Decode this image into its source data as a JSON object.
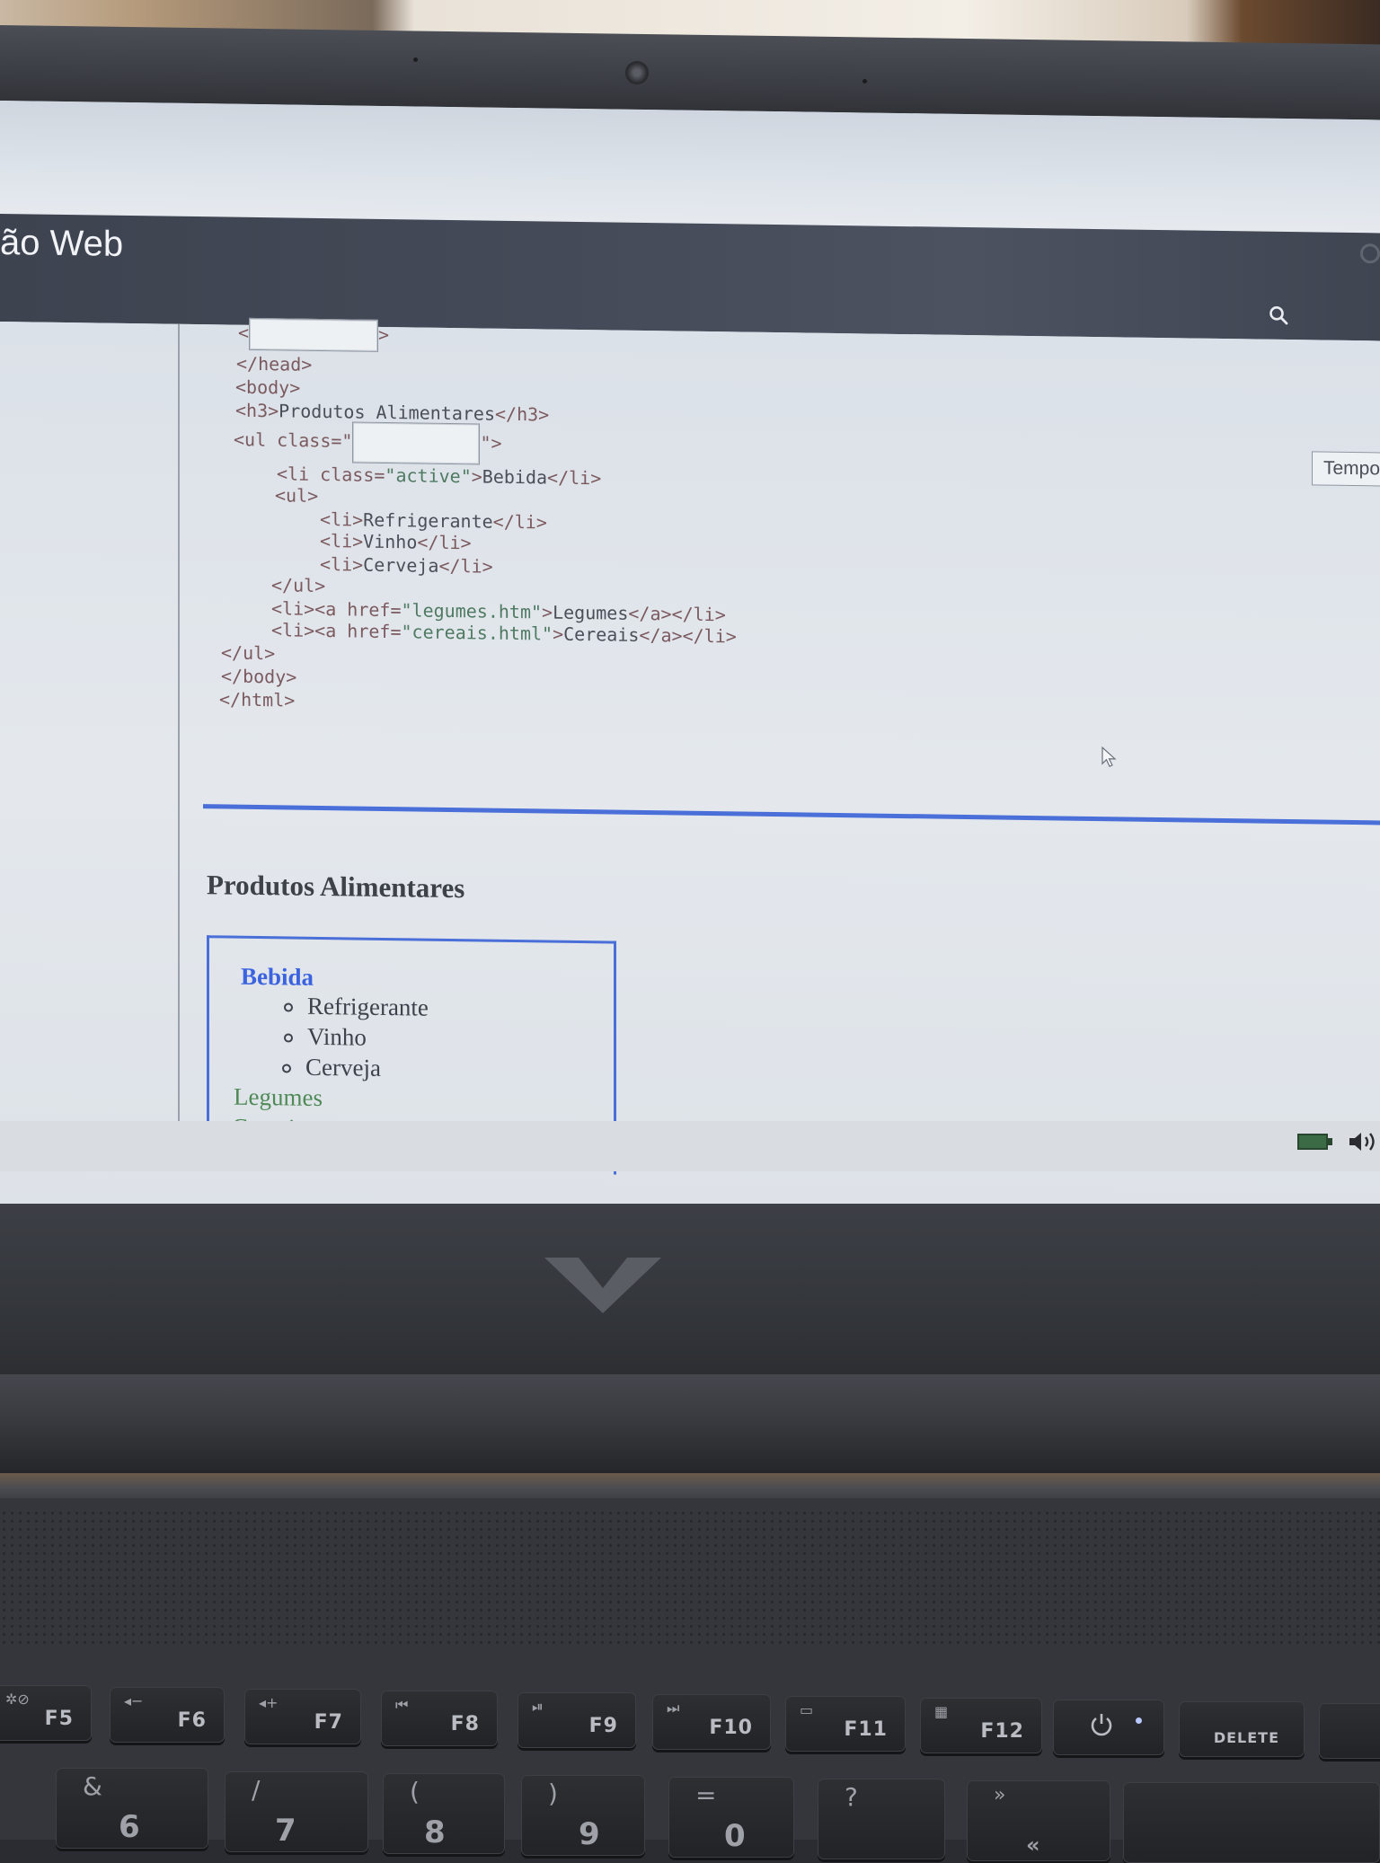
{
  "header": {
    "site_title": "ão Web"
  },
  "code": {
    "line_open_tag_left": "<",
    "line_open_tag_right": ">",
    "head_close": "</head>",
    "body_open": "<body>",
    "h3_open": "<h3>",
    "h3_text": "Produtos Alimentares",
    "h3_close": "</h3>",
    "ul_open_start": "<ul class=\"",
    "ul_open_end": "\">",
    "li_active_start": "<li class=",
    "li_active_value": "\"active\"",
    "li_active_gt": ">",
    "li_active_text": "Bebida",
    "li_close": "</li>",
    "inner_ul_open": "<ul>",
    "li_open": "<li>",
    "item1": "Refrigerante",
    "item2": "Vinho",
    "item3": "Cerveja",
    "inner_ul_close": "</ul>",
    "a_open": "<a href=",
    "href1": "\"legumes.htm\"",
    "link1": "Legumes",
    "href2": "\"cereais.html\"",
    "link2": "Cereais",
    "a_close": "</a>",
    "ul_close": "</ul>",
    "body_close": "</body>",
    "html_close": "</html>"
  },
  "toolbar": {
    "tempo_label": "Tempo"
  },
  "result": {
    "title": "Produtos Alimentares",
    "active_item": "Bebida",
    "sub_items": [
      "Refrigerante",
      "Vinho",
      "Cerveja"
    ],
    "links": [
      "Legumes",
      "Cereais"
    ]
  },
  "keyboard": {
    "fkeys": [
      {
        "label": "F5"
      },
      {
        "label": "F6"
      },
      {
        "label": "F7"
      },
      {
        "label": "F8"
      },
      {
        "label": "F9"
      },
      {
        "label": "F10"
      },
      {
        "label": "F11"
      },
      {
        "label": "F12"
      }
    ],
    "delete_label": "DELETE",
    "num_keys": [
      {
        "main": "6",
        "sub": "&"
      },
      {
        "main": "7",
        "sub": "/"
      },
      {
        "main": "8",
        "sub": "("
      },
      {
        "main": "9",
        "sub": ")"
      },
      {
        "main": "0",
        "sub": "="
      },
      {
        "main": "",
        "sub": "?"
      },
      {
        "main": "«",
        "sub": "»"
      }
    ]
  },
  "colors": {
    "accent_blue": "#4a6fd8",
    "link_green": "#4f8a56",
    "header_dark": "#444a57"
  }
}
